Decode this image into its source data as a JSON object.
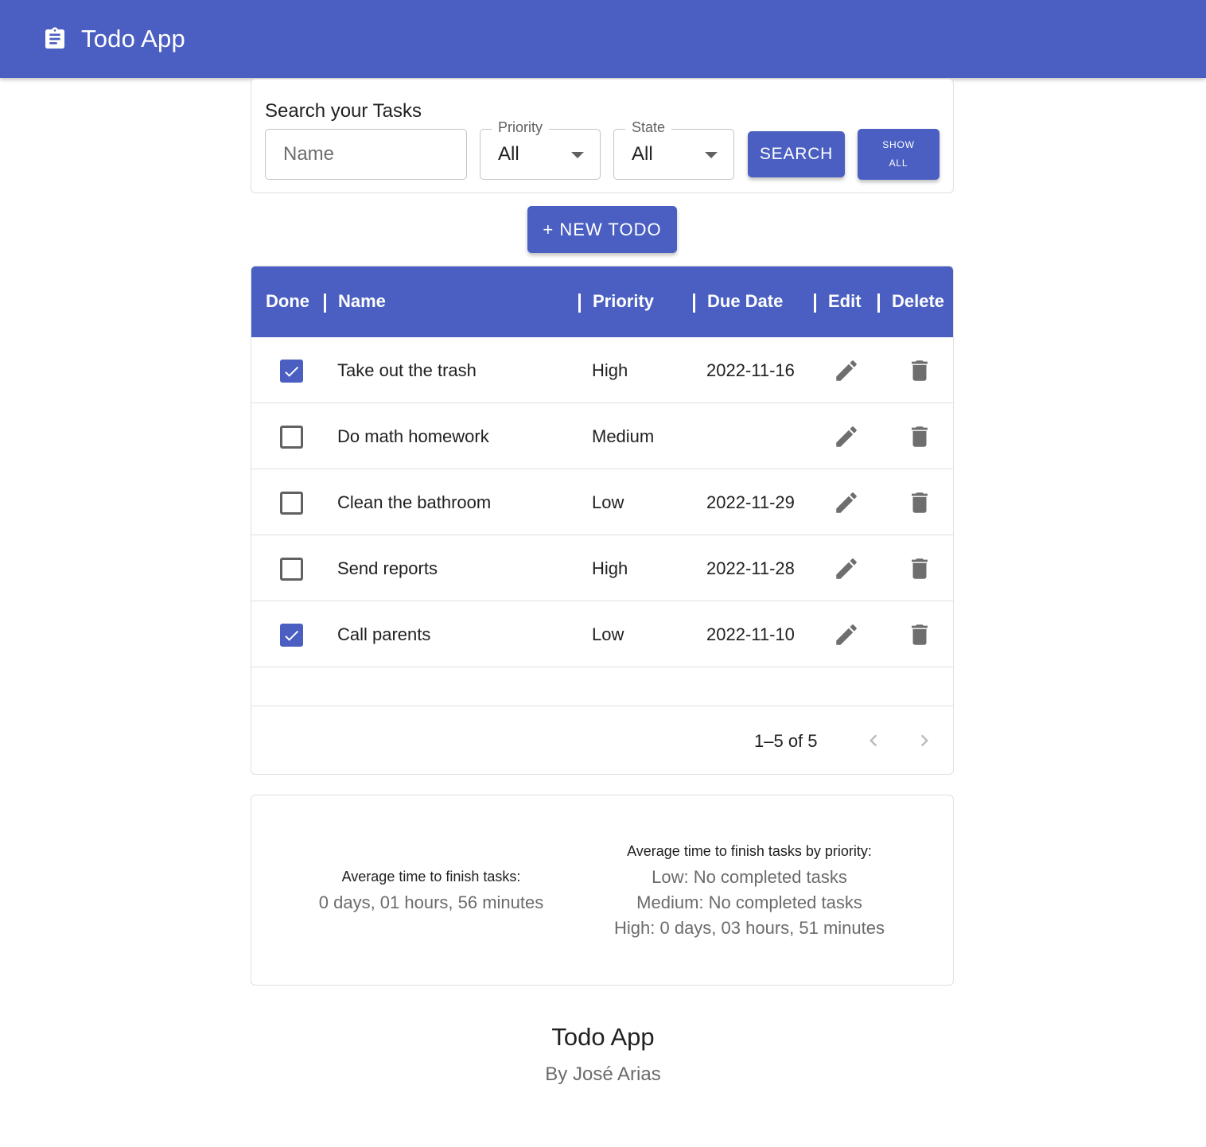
{
  "app": {
    "title": "Todo App",
    "icon": "clipboard-icon"
  },
  "search": {
    "heading": "Search your Tasks",
    "name_placeholder": "Name",
    "name_value": "",
    "priority": {
      "label": "Priority",
      "selected": "All"
    },
    "state": {
      "label": "State",
      "selected": "All"
    },
    "search_button": "SEARCH",
    "show_all_line1": "SHOW",
    "show_all_line2": "ALL"
  },
  "new_todo_button": "+ NEW TODO",
  "table": {
    "columns": [
      "Done",
      "Name",
      "Priority",
      "Due Date",
      "Edit",
      "Delete"
    ],
    "rows": [
      {
        "done": true,
        "name": "Take out the trash",
        "priority": "High",
        "due": "2022-11-16"
      },
      {
        "done": false,
        "name": "Do math homework",
        "priority": "Medium",
        "due": ""
      },
      {
        "done": false,
        "name": "Clean the bathroom",
        "priority": "Low",
        "due": "2022-11-29"
      },
      {
        "done": false,
        "name": "Send reports",
        "priority": "High",
        "due": "2022-11-28"
      },
      {
        "done": true,
        "name": "Call parents",
        "priority": "Low",
        "due": "2022-11-10"
      }
    ],
    "pagination": "1–5 of 5"
  },
  "stats": {
    "overall_label": "Average time to finish tasks:",
    "overall_value": "0 days, 01 hours, 56 minutes",
    "by_priority_label": "Average time to finish tasks by priority:",
    "low": "Low: No completed tasks",
    "medium": "Medium: No completed tasks",
    "high": "High: 0 days, 03 hours, 51 minutes"
  },
  "footer": {
    "title": "Todo App",
    "author": "By José Arias"
  },
  "colors": {
    "primary": "#4a5fc1",
    "icon_grey": "#6e6e6e"
  }
}
